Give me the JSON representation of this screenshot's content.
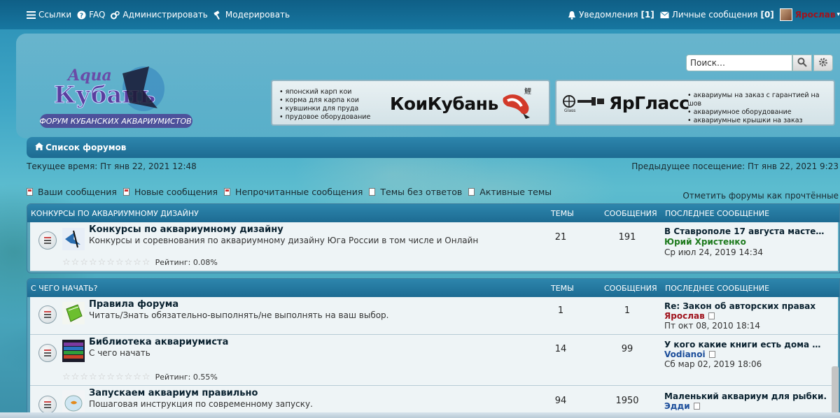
{
  "topbar": {
    "links": "Ссылки",
    "faq": "FAQ",
    "admin": "Администрировать",
    "moderate": "Модерировать",
    "notifications": "Уведомления",
    "notifications_count": "[1]",
    "messages": "Личные сообщения",
    "messages_count": "[0]",
    "username": "Ярослав"
  },
  "search": {
    "placeholder": "Поиск…"
  },
  "banners": {
    "koi": {
      "title": "КоиКубань",
      "items": [
        "японский карп кои",
        "корма для карпа кои",
        "кувшинки для пруда",
        "прудовое оборудование"
      ]
    },
    "glass": {
      "title": "ЯрГласс",
      "items": [
        "аквариумы на заказ с гарантией на шов",
        "аквариумное оборудование",
        "аквариумные крышки на заказ"
      ]
    }
  },
  "breadcrumb": {
    "label": "Список форумов"
  },
  "times": {
    "current": "Текущее время: Пт янв 22, 2021 12:48",
    "previous": "Предыдущее посещение: Пт янв 22, 2021 9:23"
  },
  "quicklinks": {
    "my_posts": "Ваши сообщения",
    "new_posts": "Новые сообщения",
    "unread_posts": "Непрочитанные сообщения",
    "unanswered": "Темы без ответов",
    "active": "Активные темы",
    "mark_read": "Отметить форумы как прочтённые"
  },
  "columns": {
    "topics": "ТЕМЫ",
    "posts": "СООБЩЕНИЯ",
    "last": "ПОСЛЕДНЕЕ СООБЩЕНИЕ"
  },
  "sections": [
    {
      "title": "КОНКУРСЫ ПО АКВАРИУМНОМУ ДИЗАЙНУ",
      "forums": [
        {
          "name": "Конкурсы по аквариумному дизайну",
          "desc": "Конкурсы и соревнования по аквариумному дизайну Юга России в том числе и Онлайн",
          "topics": "21",
          "posts": "191",
          "last_title": "В Ставрополе 17 августа масте…",
          "last_user": "Юрий Христенко",
          "last_date": "Ср июл 24, 2019 14:34",
          "rating": "Рейтинг: 0.08%"
        }
      ]
    },
    {
      "title": "С ЧЕГО НАЧАТЬ?",
      "forums": [
        {
          "name": "Правила форума",
          "desc": "Читать/Знать обязательно-выполнять/не выполнять на ваш выбор.",
          "topics": "1",
          "posts": "1",
          "last_title": "Re: Закон об авторских правах",
          "last_user": "Ярослав",
          "last_date": "Пт окт 08, 2010 18:14"
        },
        {
          "name": "Библиотека аквариумиста",
          "desc": "С чего начать",
          "topics": "14",
          "posts": "99",
          "last_title": "У кого какие книги есть дома …",
          "last_user": "Vodianoi",
          "last_date": "Сб мар 02, 2019 18:06",
          "rating": "Рейтинг: 0.55%"
        },
        {
          "name": "Запускаем аквариум правильно",
          "desc": "Пошаговая инструкция по современному запуску.",
          "topics": "94",
          "posts": "1950",
          "last_title": "Маленький аквариум для рыбки.",
          "last_user": "Эдди"
        }
      ]
    }
  ],
  "colors": {
    "topbar": "#1776a0",
    "header_bar": "#1d6b92",
    "user_green": "#1d7a1d",
    "user_admin": "#a0141e",
    "user_blue": "#1b4d9a"
  },
  "icons": [
    "menu-icon",
    "help-icon",
    "gears-icon",
    "hammer-icon",
    "bell-icon",
    "envelope-icon",
    "search-icon",
    "gear-icon",
    "home-icon"
  ]
}
